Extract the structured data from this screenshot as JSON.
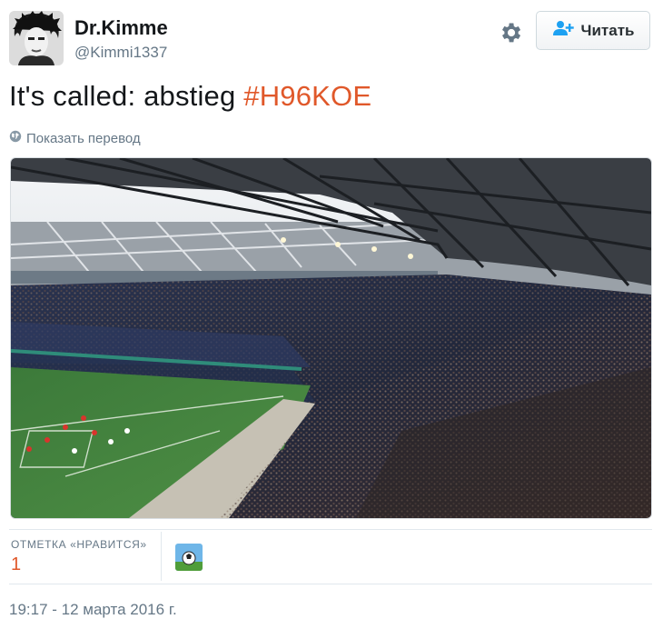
{
  "author": {
    "name": "Dr.Kimme",
    "handle": "@Kimmi1337"
  },
  "follow_button": {
    "label": "Читать"
  },
  "tweet": {
    "text": "It's called: abstieg ",
    "hashtag": "#H96KOE"
  },
  "translate_link": "Показать перевод",
  "stats": {
    "likes_label": "ОТМЕТКА «НРАВИТСЯ»",
    "likes_count": "1"
  },
  "timestamp": "19:17 - 12 марта 2016 г.",
  "colors": {
    "accent": "#e0582a",
    "muted": "#657786",
    "text": "#14171a",
    "divider": "#e1e8ed"
  },
  "icons": [
    "gear-icon",
    "add-user-icon",
    "globe-icon"
  ]
}
